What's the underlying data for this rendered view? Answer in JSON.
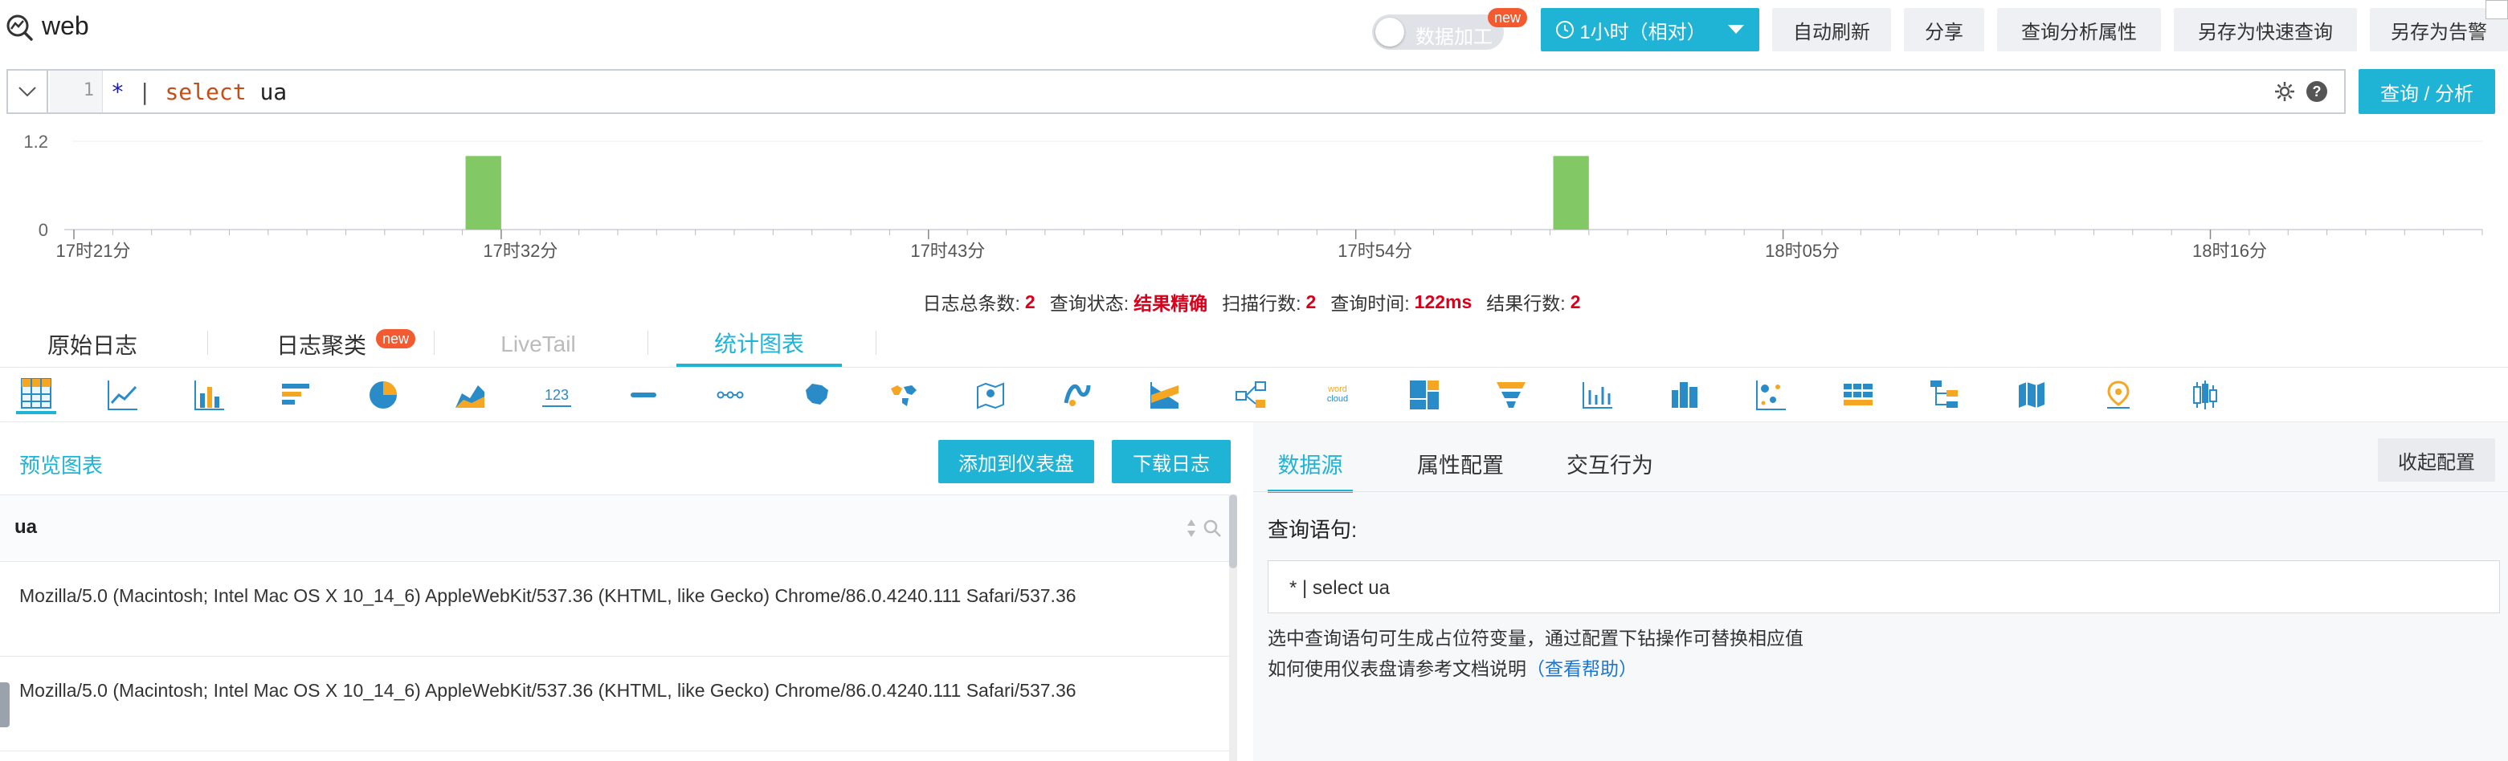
{
  "header": {
    "logstore_name": "web",
    "data_process_label": "数据加工",
    "data_process_badge": "new",
    "time_range_label": "1小时（相对）",
    "buttons": [
      "自动刷新",
      "分享",
      "查询分析属性",
      "另存为快速查询",
      "另存为告警"
    ]
  },
  "query": {
    "line_number": "1",
    "tokens": {
      "star": "*",
      "pipe": "|",
      "keyword": "select",
      "ident": "ua"
    },
    "search_button": "查询 / 分析"
  },
  "histogram": {
    "y_ticks": [
      "1.2",
      "0"
    ],
    "x_ticks": [
      "17时21分",
      "17时32分",
      "17时43分",
      "17时54分",
      "18时05分",
      "18时16分"
    ],
    "bars": [
      {
        "minute_index": 10,
        "value": 1
      },
      {
        "minute_index": 38,
        "value": 1
      }
    ],
    "minutes_total": 62,
    "ymax": 1.2,
    "bar_color": "#82c965"
  },
  "status": {
    "total_label": "日志总条数:",
    "total_value": "2",
    "state_label": "查询状态:",
    "state_value": "结果精确",
    "scan_label": "扫描行数:",
    "scan_value": "2",
    "time_label": "查询时间:",
    "time_value": "122ms",
    "result_label": "结果行数:",
    "result_value": "2"
  },
  "tabs": [
    {
      "label": "原始日志",
      "active": false,
      "disabled": false
    },
    {
      "label": "日志聚类",
      "active": false,
      "badge": "new",
      "disabled": false
    },
    {
      "label": "LiveTail",
      "active": false,
      "disabled": true
    },
    {
      "label": "统计图表",
      "active": true,
      "disabled": false
    }
  ],
  "chart_types": [
    "table-icon",
    "line-chart-icon",
    "bar-chart-icon",
    "horizontal-bar-icon",
    "pie-chart-icon",
    "area-chart-icon",
    "single-value-icon",
    "progress-bar-icon",
    "map-dots-icon",
    "china-map-icon",
    "world-map-icon",
    "amap-icon",
    "flow-chart-icon",
    "sankey-icon",
    "topology-icon",
    "word-cloud-icon",
    "treemap-icon",
    "funnel-icon",
    "timeline-icon",
    "cross-table-icon",
    "scatter-icon",
    "heatmap-table-icon",
    "hierarchy-icon",
    "calendar-map-icon",
    "location-icon",
    "candlestick-icon"
  ],
  "preview": {
    "title": "预览图表",
    "add_dashboard": "添加到仪表盘",
    "download_log": "下载日志",
    "column_header": "ua",
    "rows": [
      "Mozilla/5.0 (Macintosh; Intel Mac OS X 10_14_6) AppleWebKit/537.36 (KHTML, like Gecko) Chrome/86.0.4240.111 Safari/537.36",
      "Mozilla/5.0 (Macintosh; Intel Mac OS X 10_14_6) AppleWebKit/537.36 (KHTML, like Gecko) Chrome/86.0.4240.111 Safari/537.36"
    ]
  },
  "config": {
    "tabs": [
      "数据源",
      "属性配置",
      "交互行为"
    ],
    "collapse": "收起配置",
    "query_label": "查询语句:",
    "query_value": "* | select ua",
    "hint1": "选中查询语句可生成占位符变量，通过配置下钻操作可替换相应值",
    "hint2_prefix": "如何使用仪表盘请参考文档说明",
    "hint2_link": "（查看帮助）"
  },
  "colors": {
    "accent": "#1fb4d6",
    "badge": "#f45a30",
    "error_red": "#d9001b"
  }
}
